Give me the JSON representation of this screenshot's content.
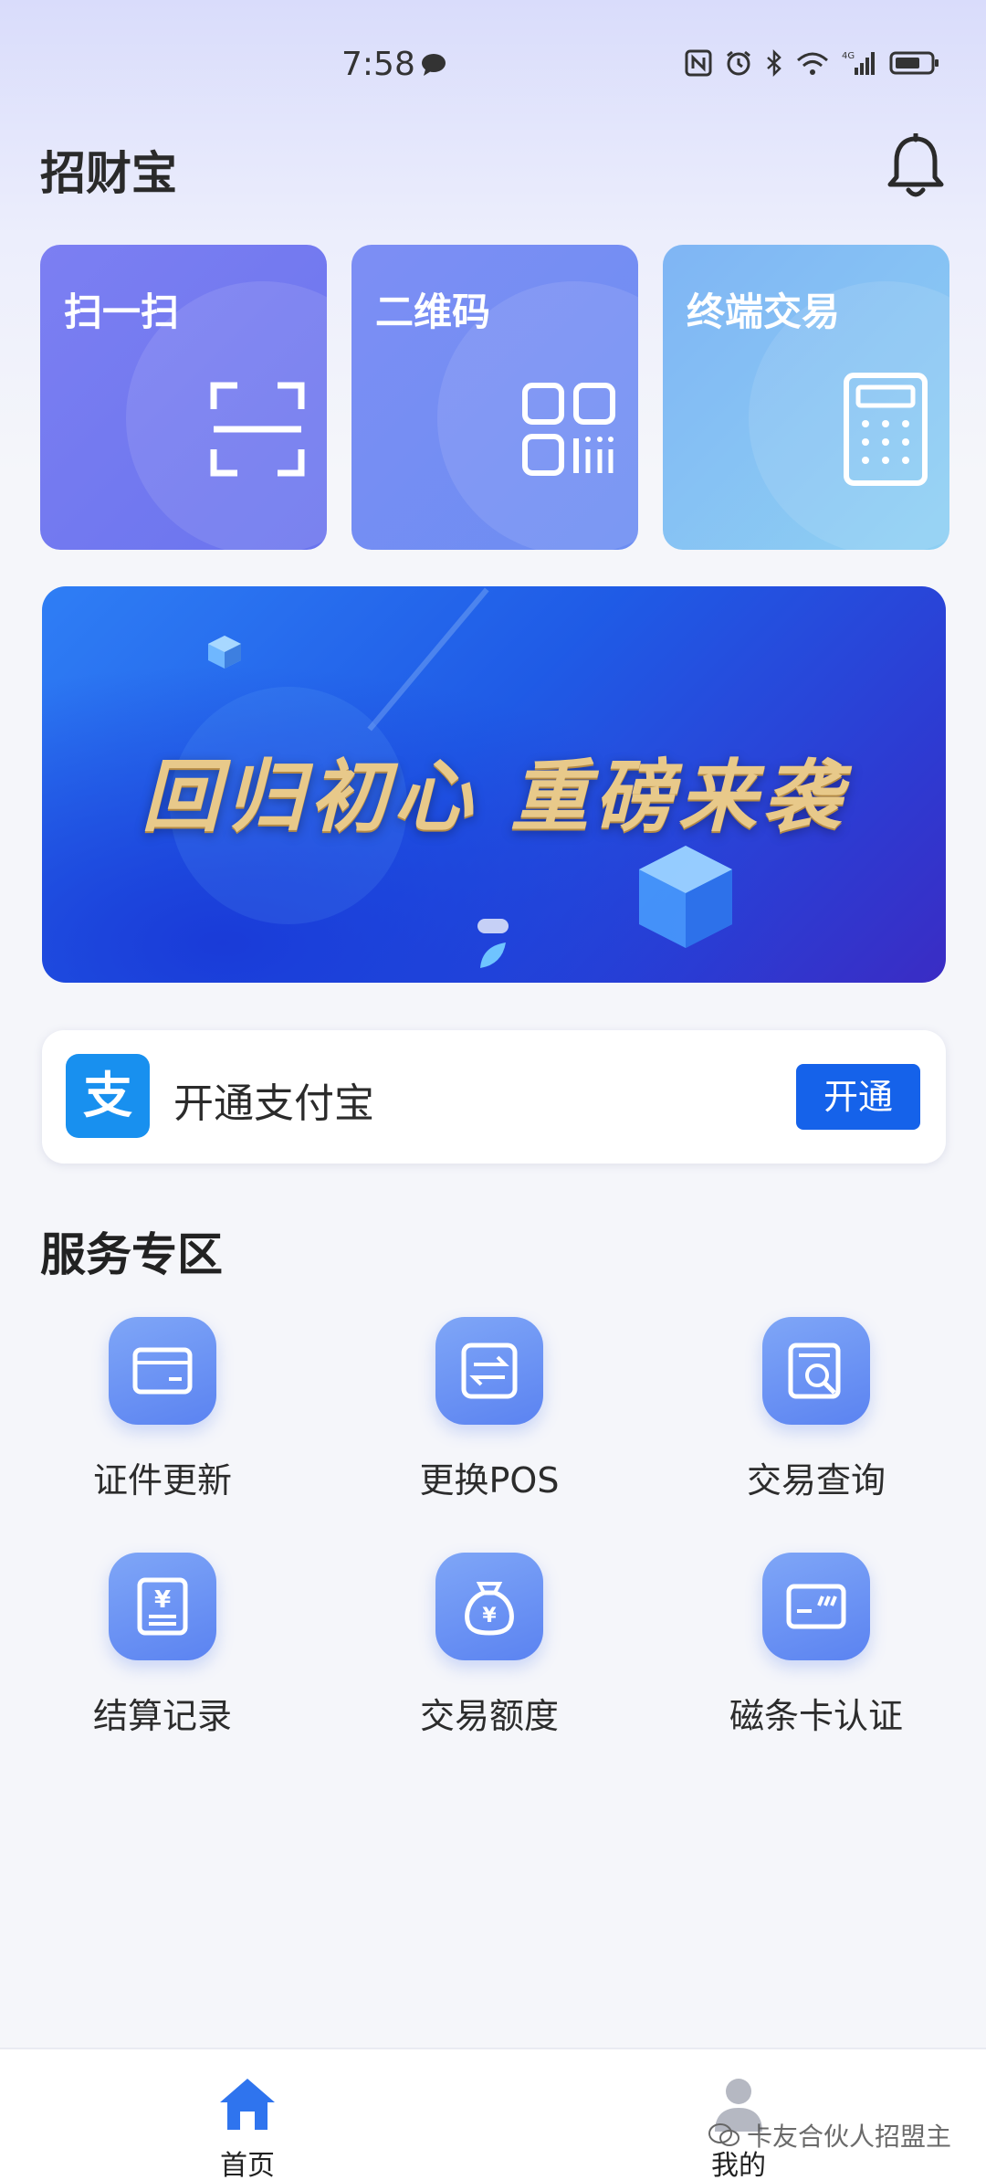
{
  "status_bar": {
    "time": "7:58",
    "network": "4G"
  },
  "header": {
    "title": "招财宝"
  },
  "tiles": [
    {
      "label": "扫一扫",
      "icon": "scan-icon"
    },
    {
      "label": "二维码",
      "icon": "qr-code-icon"
    },
    {
      "label": "终端交易",
      "icon": "calculator-icon"
    }
  ],
  "banner": {
    "text": "回归初心  重磅来袭",
    "slide_index": 1
  },
  "alipay": {
    "label": "开通支付宝",
    "button": "开通",
    "logo_char": "支"
  },
  "services": {
    "title": "服务专区",
    "items": [
      {
        "label": "证件更新",
        "icon": "id-card-icon"
      },
      {
        "label": "更换POS",
        "icon": "swap-icon"
      },
      {
        "label": "交易查询",
        "icon": "search-document-icon"
      },
      {
        "label": "结算记录",
        "icon": "settlement-receipt-icon"
      },
      {
        "label": "交易额度",
        "icon": "money-bag-icon"
      },
      {
        "label": "磁条卡认证",
        "icon": "bank-card-icon"
      }
    ]
  },
  "bottom_nav": {
    "home": "首页",
    "me": "我的"
  },
  "watermark": "卡友合伙人招盟主",
  "colors": {
    "primary": "#1562ea",
    "tile1": "#7c7ff2",
    "tile2": "#7d8ef4",
    "tile3": "#8ed0f3",
    "service": "#5b83f1"
  }
}
